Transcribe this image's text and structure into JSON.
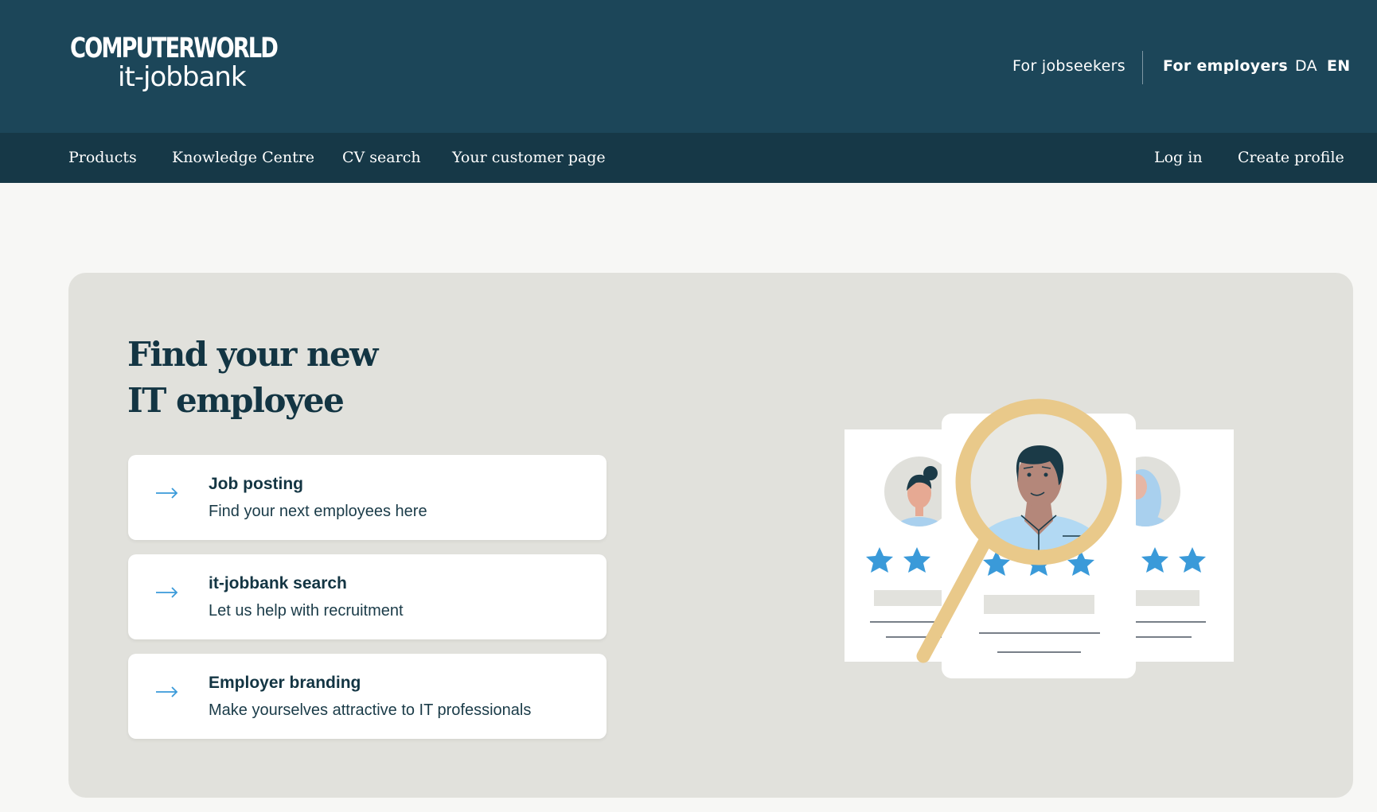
{
  "logo": {
    "line1": "COMPUTERWORLD",
    "line2": "it-jobbank"
  },
  "audience_nav": {
    "jobseekers": "For jobseekers",
    "employers": "For employers"
  },
  "languages": {
    "da": "DA",
    "en": "EN",
    "active": "EN"
  },
  "subnav": {
    "left": [
      "Products",
      "Knowledge Centre",
      "CV search",
      "Your customer page"
    ],
    "right": [
      "Log in",
      "Create profile"
    ]
  },
  "hero": {
    "title_line1": "Find your new",
    "title_line2": "IT employee",
    "cards": [
      {
        "title": "Job posting",
        "description": "Find your next employees here",
        "icon": "arrow-right-icon"
      },
      {
        "title": "it-jobbank search",
        "description": "Let us help with recruitment",
        "icon": "arrow-right-icon"
      },
      {
        "title": "Employer branding",
        "description": "Make yourselves attractive to IT professionals",
        "icon": "arrow-right-icon"
      }
    ],
    "illustration": "candidate-search-illustration"
  },
  "colors": {
    "header_bg": "#1c4659",
    "subnav_bg": "#163847",
    "page_bg": "#f7f7f5",
    "hero_bg": "#e1e1dc",
    "text_dark": "#133543",
    "accent_blue": "#3a9ad9",
    "magnifier_gold": "#e9c98a"
  }
}
